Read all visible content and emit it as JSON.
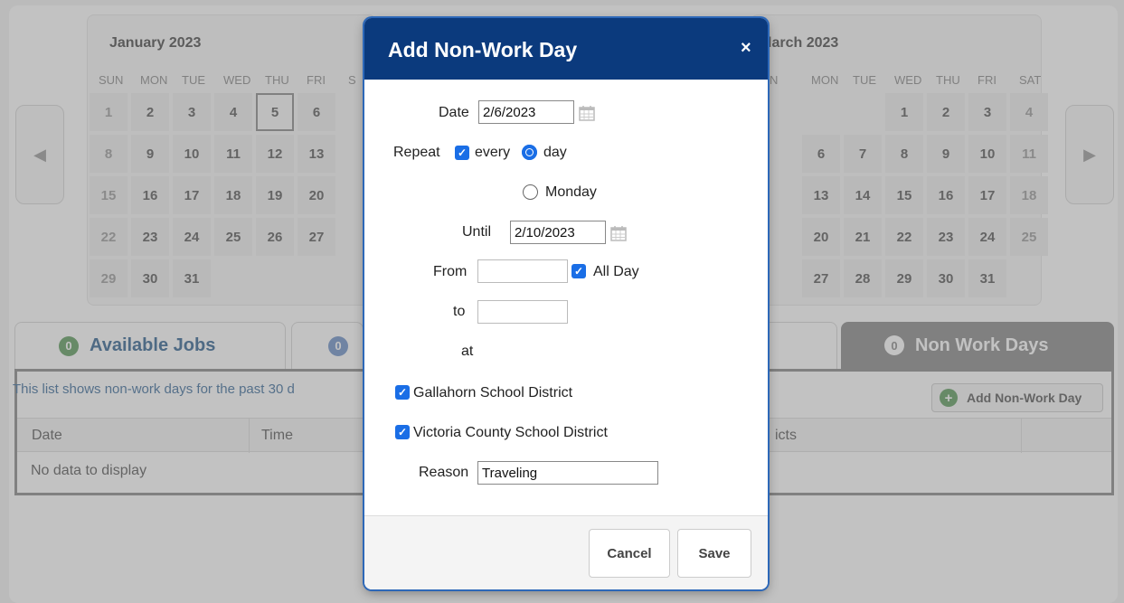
{
  "background": {
    "calendar_left": {
      "title": "January 2023",
      "days_of_week": [
        "SUN",
        "MON",
        "TUE",
        "WED",
        "THU",
        "FRI",
        "S"
      ],
      "weeks": [
        [
          "1",
          "2",
          "3",
          "4",
          "5",
          "6"
        ],
        [
          "8",
          "9",
          "10",
          "11",
          "12",
          "13"
        ],
        [
          "15",
          "16",
          "17",
          "18",
          "19",
          "20"
        ],
        [
          "22",
          "23",
          "24",
          "25",
          "26",
          "27"
        ],
        [
          "29",
          "30",
          "31"
        ]
      ]
    },
    "calendar_right": {
      "title": "larch 2023",
      "days_of_week": [
        "N",
        "MON",
        "TUE",
        "WED",
        "THU",
        "FRI",
        "SAT"
      ],
      "weeks": [
        [
          "",
          "",
          "",
          "1",
          "2",
          "3",
          "4"
        ],
        [
          "",
          "6",
          "7",
          "8",
          "9",
          "10",
          "11"
        ],
        [
          "",
          "13",
          "14",
          "15",
          "16",
          "17",
          "18"
        ],
        [
          "",
          "20",
          "21",
          "22",
          "23",
          "24",
          "25"
        ],
        [
          "",
          "27",
          "28",
          "29",
          "30",
          "31"
        ]
      ]
    },
    "tabs": {
      "available_jobs": {
        "count": "0",
        "label": "Available Jobs"
      },
      "second": {
        "count": "0"
      },
      "non_work_days": {
        "count": "0",
        "label": "Non Work Days"
      }
    },
    "grid": {
      "note": "This list shows non-work days for the past 30 d",
      "add_button_label": "Add Non-Work Day",
      "columns": [
        "Date",
        "Time",
        "icts"
      ],
      "empty_text": "No data to display"
    }
  },
  "dialog": {
    "title": "Add Non-Work Day",
    "close_symbol": "×",
    "date_label": "Date",
    "date_value": "2/6/2023",
    "repeat_label": "Repeat",
    "repeat_every_label": "every",
    "repeat_day_label": "day",
    "repeat_monday_label": "Monday",
    "until_label": "Until",
    "until_value": "2/10/2023",
    "from_label": "From",
    "from_value": "",
    "all_day_label": "All Day",
    "to_label": "to",
    "to_value": "",
    "at_label": "at",
    "districts": [
      {
        "label": "Gallahorn School District",
        "checked": true
      },
      {
        "label": "Victoria County School District",
        "checked": true
      }
    ],
    "reason_label": "Reason",
    "reason_value": "Traveling",
    "cancel_label": "Cancel",
    "save_label": "Save"
  },
  "colors": {
    "dialog_header": "#0b3a7d",
    "checkbox": "#1a6ee6",
    "overlay": "#787878"
  }
}
